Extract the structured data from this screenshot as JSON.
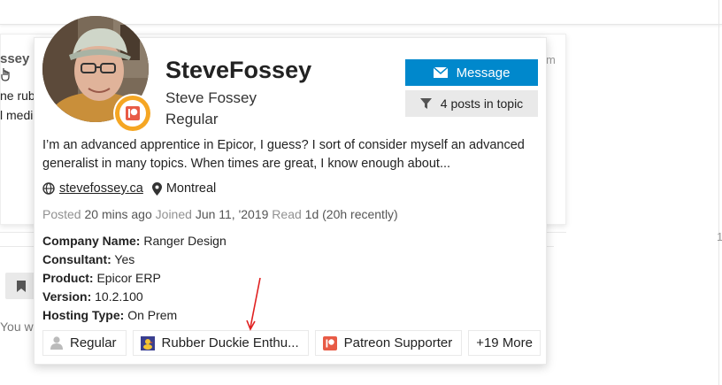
{
  "background": {
    "username_fragment": "ssey",
    "line1_fragment": "ne rub",
    "line2_fragment": "l medi",
    "right_fragment": "m",
    "right_number_fragment": "1",
    "bottom_fragment": "You w"
  },
  "card": {
    "username": "SteveFossey",
    "full_name": "Steve Fossey",
    "title": "Regular",
    "message_button": "Message",
    "posts_filter_button": "4 posts in topic",
    "bio": "I’m an advanced apprentice in Epicor, I guess? I sort of consider myself an advanced generalist in many topics. When times are great, I know enough about...",
    "website": "stevefossey.ca",
    "location": "Montreal",
    "meta": {
      "posted_label": "Posted",
      "posted_value": "20 mins ago",
      "joined_label": "Joined",
      "joined_value": "Jun 11, '2019",
      "read_label": "Read",
      "read_value": "1d (20h recently)"
    },
    "fields": [
      {
        "name": "Company Name:",
        "value": "Ranger Design"
      },
      {
        "name": "Consultant:",
        "value": "Yes"
      },
      {
        "name": "Product:",
        "value": "Epicor ERP"
      },
      {
        "name": "Version:",
        "value": "10.2.100"
      },
      {
        "name": "Hosting Type:",
        "value": "On Prem"
      }
    ],
    "badges": [
      {
        "label": "Regular",
        "icon": "user-icon"
      },
      {
        "label": "Rubber Duckie Enthu...",
        "icon": "duck-image-icon"
      },
      {
        "label": "Patreon Supporter",
        "icon": "patreon-icon"
      },
      {
        "label": "+19 More",
        "icon": ""
      }
    ]
  },
  "colors": {
    "primary_button": "#0088cc",
    "secondary_button": "#e9e9e9",
    "flair_background": "#f5a623",
    "patreon": "#e85b46",
    "annotation_arrow": "#e02020"
  }
}
